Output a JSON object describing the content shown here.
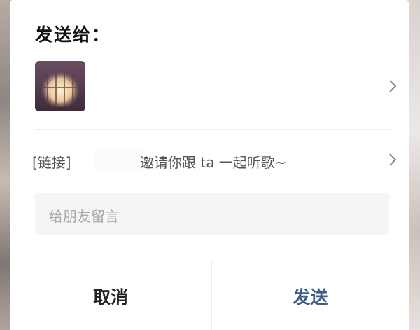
{
  "dialog": {
    "title": "发送给：",
    "recipient": {
      "avatar_icon": "recipient-avatar-image",
      "name": "",
      "chevron_icon": "chevron-right-icon"
    },
    "link": {
      "prefix": "[链接]",
      "text": "邀请你跟 ta 一起听歌~",
      "chevron_icon": "chevron-right-icon"
    },
    "message": {
      "placeholder": "给朋友留言"
    },
    "buttons": {
      "cancel_label": "取消",
      "send_label": "发送"
    },
    "colors": {
      "send_accent": "#3e5d86",
      "input_background": "#f5f5f5"
    }
  }
}
